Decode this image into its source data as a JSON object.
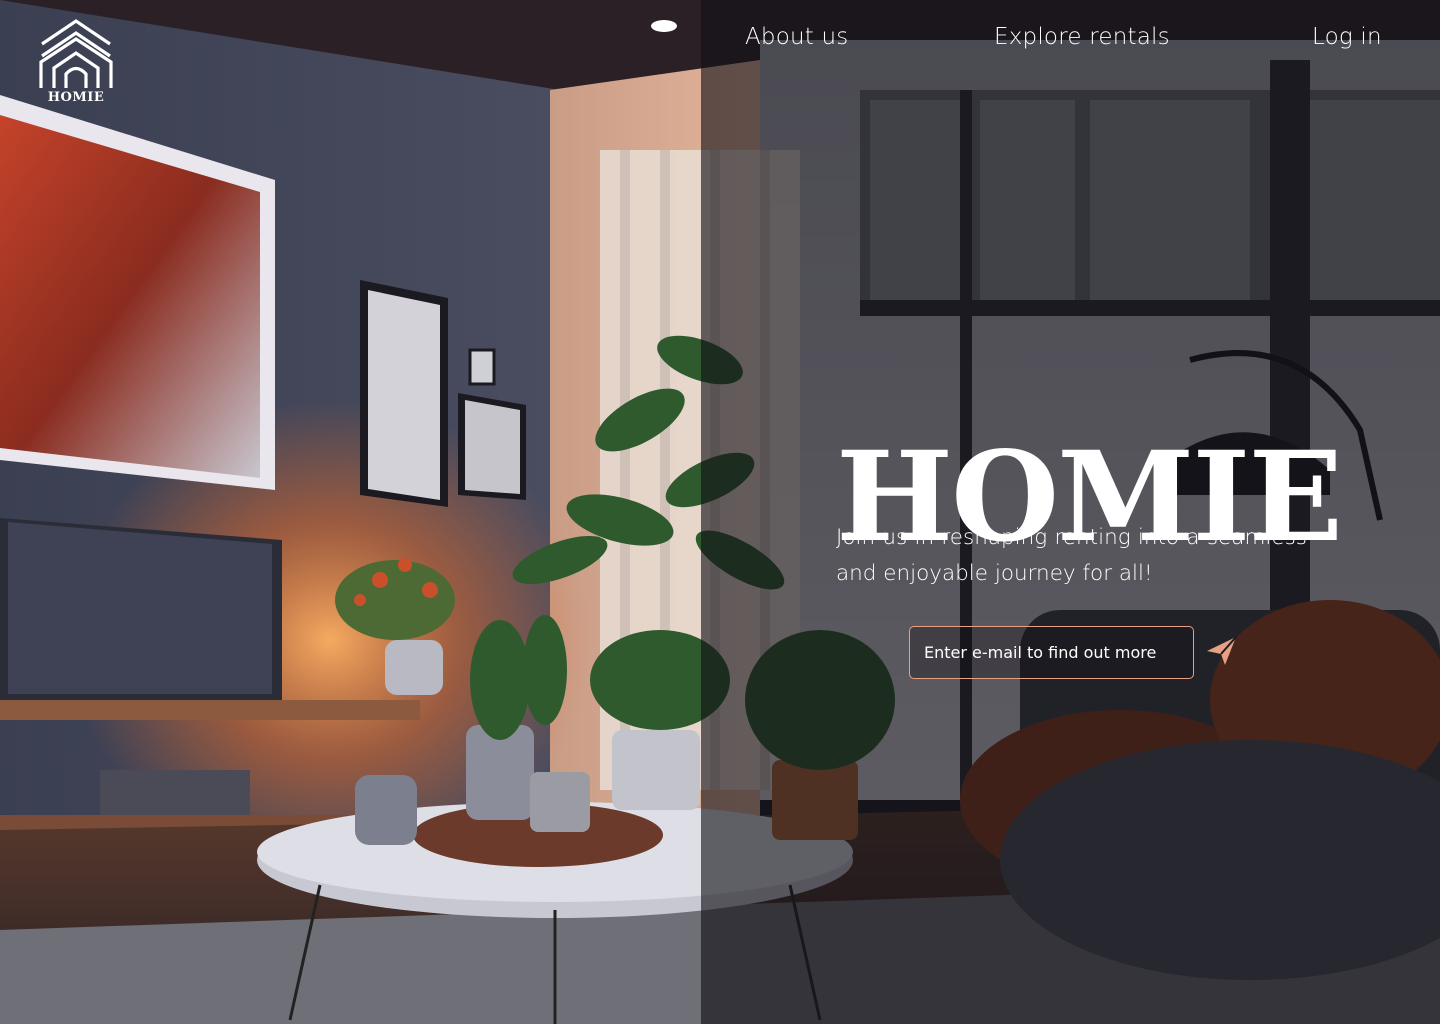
{
  "brand": {
    "logo_text": "HOMIE",
    "accent_color": "#e7a082"
  },
  "nav": {
    "items": [
      {
        "label": "About us"
      },
      {
        "label": "Explore rentals"
      },
      {
        "label": "Log in"
      }
    ]
  },
  "hero": {
    "title": "HOMIE",
    "tagline": "Join us in reshaping renting into a seamless and enjoyable journey for all!",
    "email_placeholder": "Enter e-mail to find out more",
    "email_value": "",
    "submit_icon": "paper-plane-icon"
  }
}
